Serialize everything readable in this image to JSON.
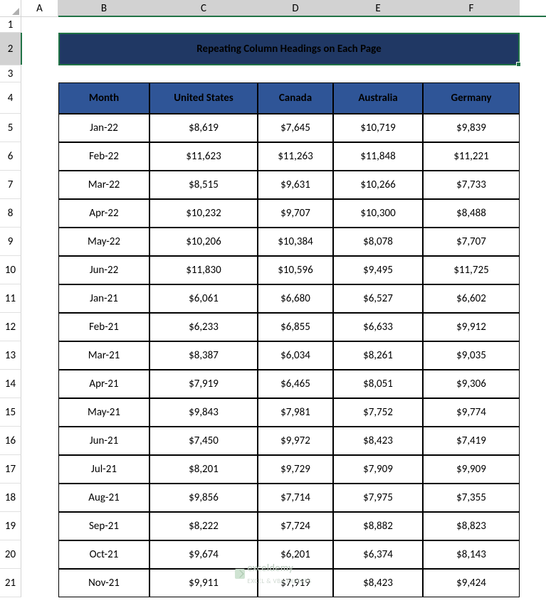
{
  "columns": [
    "A",
    "B",
    "C",
    "D",
    "E",
    "F"
  ],
  "row_numbers": [
    1,
    2,
    3,
    4,
    5,
    6,
    7,
    8,
    9,
    10,
    11,
    12,
    13,
    14,
    15,
    16,
    17,
    18,
    19,
    20,
    21
  ],
  "title": "Repeating Column Headings on Each Page",
  "headers": [
    "Month",
    "United States",
    "Canada",
    "Australia",
    "Germany"
  ],
  "rows": [
    {
      "month": "Jan-22",
      "us": "$8,619",
      "ca": "$7,645",
      "au": "$10,719",
      "de": "$9,839"
    },
    {
      "month": "Feb-22",
      "us": "$11,623",
      "ca": "$11,263",
      "au": "$11,848",
      "de": "$11,221"
    },
    {
      "month": "Mar-22",
      "us": "$8,515",
      "ca": "$9,631",
      "au": "$10,266",
      "de": "$7,733"
    },
    {
      "month": "Apr-22",
      "us": "$10,232",
      "ca": "$9,707",
      "au": "$10,300",
      "de": "$8,488"
    },
    {
      "month": "May-22",
      "us": "$10,206",
      "ca": "$10,384",
      "au": "$8,078",
      "de": "$7,707"
    },
    {
      "month": "Jun-22",
      "us": "$11,830",
      "ca": "$10,596",
      "au": "$9,495",
      "de": "$11,725"
    },
    {
      "month": "Jan-21",
      "us": "$6,061",
      "ca": "$6,680",
      "au": "$6,527",
      "de": "$6,602"
    },
    {
      "month": "Feb-21",
      "us": "$6,233",
      "ca": "$6,855",
      "au": "$6,633",
      "de": "$9,912"
    },
    {
      "month": "Mar-21",
      "us": "$8,387",
      "ca": "$6,034",
      "au": "$8,261",
      "de": "$9,035"
    },
    {
      "month": "Apr-21",
      "us": "$7,919",
      "ca": "$6,465",
      "au": "$8,051",
      "de": "$9,306"
    },
    {
      "month": "May-21",
      "us": "$9,843",
      "ca": "$7,981",
      "au": "$7,752",
      "de": "$9,774"
    },
    {
      "month": "Jun-21",
      "us": "$7,450",
      "ca": "$9,972",
      "au": "$8,423",
      "de": "$7,419"
    },
    {
      "month": "Jul-21",
      "us": "$8,201",
      "ca": "$9,729",
      "au": "$7,909",
      "de": "$9,909"
    },
    {
      "month": "Aug-21",
      "us": "$9,856",
      "ca": "$7,714",
      "au": "$7,975",
      "de": "$7,355"
    },
    {
      "month": "Sep-21",
      "us": "$8,222",
      "ca": "$7,724",
      "au": "$8,882",
      "de": "$8,823"
    },
    {
      "month": "Oct-21",
      "us": "$9,674",
      "ca": "$6,201",
      "au": "$6,374",
      "de": "$8,143"
    },
    {
      "month": "Nov-21",
      "us": "$9,911",
      "ca": "$7,919",
      "au": "$8,423",
      "de": "$9,424"
    }
  ],
  "watermark": {
    "brand": "exceldemy",
    "tag": "EXCEL & VBA EXPERTS"
  }
}
